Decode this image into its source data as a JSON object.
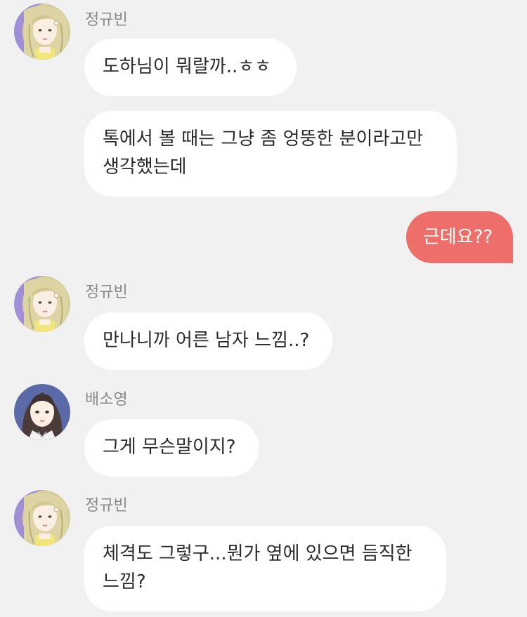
{
  "messages": [
    {
      "sender": "정규빈",
      "text": "도하님이 뭐랄까..ㅎㅎ"
    },
    {
      "text": "톡에서 볼 때는 그냥 좀 엉뚱한 분이라고만\n생각했는데"
    },
    {
      "text": "근데요??"
    },
    {
      "sender": "정규빈",
      "text": "만나니까 어른 남자 느낌..?"
    },
    {
      "sender": "배소영",
      "text": "그게 무슨말이지?"
    },
    {
      "sender": "정규빈",
      "text": "체격도 그렇구...뭔가 옆에 있으면 듬직한\n느낌?"
    }
  ],
  "colors": {
    "background": "#f1f1f1",
    "incoming_bubble": "#ffffff",
    "outgoing_bubble": "#ee6e69",
    "sender_name": "#8a8a8a"
  },
  "icons": {
    "avatar_a": "avatar-blonde-girl-icon",
    "avatar_b": "avatar-dark-hair-girl-icon"
  }
}
